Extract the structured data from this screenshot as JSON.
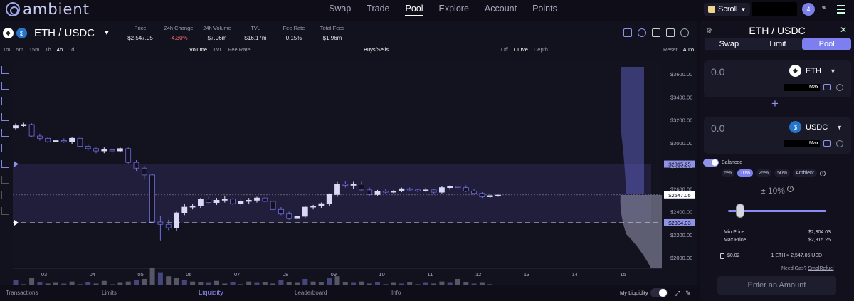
{
  "brand": {
    "name": "ambient"
  },
  "nav": {
    "links": [
      "Swap",
      "Trade",
      "Pool",
      "Explore",
      "Account",
      "Points"
    ],
    "active": "Pool"
  },
  "network": {
    "name": "Scroll"
  },
  "notifications": {
    "count": "4"
  },
  "pair": {
    "name": "ETH / USDC",
    "base": "ETH",
    "quote": "USDC"
  },
  "stats": [
    {
      "label": "Price",
      "value": "$2,547.05"
    },
    {
      "label": "24h Change",
      "value": "-4.30%"
    },
    {
      "label": "24h Volume",
      "value": "$7.96m"
    },
    {
      "label": "TVL",
      "value": "$16.17m"
    },
    {
      "label": "Fee Rate",
      "value": "0.15%"
    },
    {
      "label": "Total Fees",
      "value": "$1.96m"
    }
  ],
  "timeframes": [
    "1m",
    "5m",
    "15m",
    "1h",
    "4h",
    "1d"
  ],
  "timeframe_active": "4h",
  "overlays": [
    "Volume",
    "TVL",
    "Fee Rate"
  ],
  "overlay_active": "Volume",
  "buys_sells": "Buys/Sells",
  "liquidity_modes": [
    "Off",
    "Curve",
    "Depth"
  ],
  "liquidity_mode_active": "Curve",
  "scale_controls": [
    "Reset",
    "Auto"
  ],
  "scale_active": "Auto",
  "chart_data": {
    "type": "candlestick",
    "x_tick_labels": [
      "03",
      "04",
      "05",
      "06",
      "07",
      "08",
      "09",
      "10",
      "11",
      "12",
      "13",
      "14",
      "15"
    ],
    "y_tick_labels": [
      "$3600.00",
      "$3400.00",
      "$3200.00",
      "$3000.00",
      "$2800.00",
      "$2600.00",
      "$2400.00",
      "$2200.00",
      "$2000.00"
    ],
    "ylim": [
      2000,
      3600
    ],
    "range_max": 2815.25,
    "range_max_label": "$2815.25",
    "current_price": 2547.05,
    "current_price_label": "$2547.05",
    "range_min": 2304.03,
    "range_min_label": "$2304.03",
    "candles": [
      [
        3130,
        3170,
        3110,
        3150
      ],
      [
        3150,
        3175,
        3140,
        3160
      ],
      [
        3160,
        3170,
        3050,
        3060
      ],
      [
        3060,
        3080,
        3020,
        3040
      ],
      [
        3040,
        3050,
        3000,
        3010
      ],
      [
        3010,
        3030,
        2990,
        3020
      ],
      [
        3020,
        3040,
        3000,
        3010
      ],
      [
        3010,
        3050,
        2990,
        3040
      ],
      [
        3040,
        3060,
        2960,
        2970
      ],
      [
        2970,
        2990,
        2930,
        2950
      ],
      [
        2950,
        2960,
        2910,
        2930
      ],
      [
        2930,
        2960,
        2910,
        2940
      ],
      [
        2940,
        2950,
        2910,
        2930
      ],
      [
        2930,
        2960,
        2920,
        2950
      ],
      [
        2950,
        2960,
        2820,
        2830
      ],
      [
        2830,
        2850,
        2750,
        2780
      ],
      [
        2780,
        2800,
        2680,
        2720
      ],
      [
        2720,
        2730,
        2300,
        2310
      ],
      [
        2310,
        2360,
        2150,
        2290
      ],
      [
        2290,
        2330,
        2240,
        2260
      ],
      [
        2260,
        2400,
        2230,
        2390
      ],
      [
        2390,
        2470,
        2370,
        2440
      ],
      [
        2440,
        2470,
        2420,
        2450
      ],
      [
        2450,
        2520,
        2430,
        2510
      ],
      [
        2510,
        2530,
        2470,
        2480
      ],
      [
        2480,
        2520,
        2460,
        2500
      ],
      [
        2500,
        2540,
        2480,
        2510
      ],
      [
        2510,
        2520,
        2460,
        2470
      ],
      [
        2470,
        2510,
        2450,
        2490
      ],
      [
        2490,
        2520,
        2470,
        2500
      ],
      [
        2500,
        2530,
        2480,
        2520
      ],
      [
        2520,
        2530,
        2480,
        2490
      ],
      [
        2490,
        2500,
        2400,
        2420
      ],
      [
        2420,
        2440,
        2370,
        2380
      ],
      [
        2380,
        2400,
        2330,
        2340
      ],
      [
        2340,
        2370,
        2330,
        2360
      ],
      [
        2360,
        2450,
        2340,
        2440
      ],
      [
        2440,
        2460,
        2420,
        2450
      ],
      [
        2450,
        2480,
        2430,
        2470
      ],
      [
        2470,
        2560,
        2450,
        2550
      ],
      [
        2550,
        2660,
        2530,
        2640
      ],
      [
        2640,
        2670,
        2610,
        2630
      ],
      [
        2630,
        2660,
        2600,
        2640
      ],
      [
        2640,
        2660,
        2580,
        2590
      ],
      [
        2590,
        2610,
        2540,
        2550
      ],
      [
        2550,
        2590,
        2540,
        2580
      ],
      [
        2580,
        2600,
        2560,
        2570
      ],
      [
        2570,
        2590,
        2560,
        2580
      ],
      [
        2580,
        2610,
        2570,
        2600
      ],
      [
        2600,
        2610,
        2580,
        2590
      ],
      [
        2590,
        2600,
        2570,
        2580
      ],
      [
        2580,
        2610,
        2570,
        2590
      ],
      [
        2590,
        2600,
        2560,
        2570
      ],
      [
        2570,
        2620,
        2560,
        2610
      ],
      [
        2610,
        2630,
        2590,
        2620
      ],
      [
        2620,
        2680,
        2600,
        2610
      ],
      [
        2610,
        2630,
        2570,
        2580
      ],
      [
        2580,
        2600,
        2550,
        2560
      ],
      [
        2560,
        2570,
        2520,
        2530
      ],
      [
        2530,
        2550,
        2520,
        2540
      ],
      [
        2540,
        2550,
        2530,
        2545
      ]
    ],
    "volumes": [
      12,
      6,
      16,
      9,
      7,
      8,
      7,
      10,
      6,
      9,
      7,
      11,
      6,
      8,
      10,
      12,
      14,
      30,
      24,
      18,
      16,
      12,
      10,
      9,
      8,
      11,
      7,
      9,
      6,
      10,
      8,
      9,
      7,
      12,
      9,
      8,
      14,
      10,
      9,
      16,
      18,
      9,
      8,
      10,
      7,
      9,
      6,
      8,
      7,
      9,
      6,
      8,
      7,
      10,
      8,
      14,
      9,
      7,
      8,
      6,
      5
    ]
  },
  "chart_tools": {
    "icons": [
      "bar-chart-icon",
      "dollar-icon",
      "fullscreen-icon",
      "copy-icon",
      "settings-icon"
    ]
  },
  "bottom_tabs": [
    "Transactions",
    "Limits",
    "Liquidity",
    "Leaderboard",
    "Info"
  ],
  "bottom_tab_active": "Liquidity",
  "my_liquidity_label": "My Liquidity",
  "panel": {
    "title": "ETH / USDC",
    "tabs": [
      "Swap",
      "Limit",
      "Pool"
    ],
    "tab_active": "Pool",
    "token_a": {
      "amount": "0.0",
      "symbol": "ETH",
      "max": "Max"
    },
    "token_b": {
      "amount": "0.0",
      "symbol": "USDC",
      "max": "Max"
    },
    "balanced_label": "Balanced",
    "range_widths": [
      "5%",
      "10%",
      "25%",
      "50%",
      "Ambient"
    ],
    "range_width_active": "10%",
    "range_display": "± 10%",
    "slider_value": 10,
    "min_price_label": "Min Price",
    "min_price": "$2,304.03",
    "max_price_label": "Max Price",
    "max_price": "$2,815.25",
    "gas": "$0.02",
    "rate": "1 ETH ≈ 2,547.05 USD",
    "need_gas": "Need Gas?",
    "smolrefuel": "SmolRefuel",
    "enter_label": "Enter an Amount"
  },
  "colors": {
    "accent": "#7d7ff0",
    "candle_up": "#d9d9f7",
    "candle_down": "#6d6de0",
    "negative": "#ff6b6b",
    "bg": "#0e0d18"
  }
}
